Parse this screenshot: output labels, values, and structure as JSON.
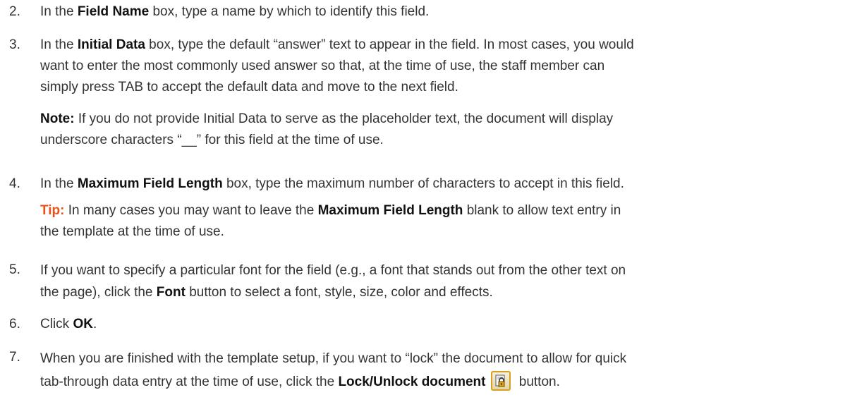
{
  "steps": [
    {
      "num": "2.",
      "parts": [
        "In the ",
        "Field Name",
        " box, type a name by which to identify this field."
      ]
    },
    {
      "num": "3.",
      "lines": [
        [
          "In the ",
          "Initial Data",
          " box, type the default “answer” text to appear in the field. In most cases, you would"
        ],
        "want to enter the most commonly used answer so that, at the time of use, the staff member can",
        "simply press TAB to accept the default data and move to the next field."
      ],
      "note": {
        "label": "Note:",
        "line1": " If you do not provide Initial Data to serve as the placeholder text, the document will display",
        "line2": "underscore characters “__” for this field at the time of use."
      }
    },
    {
      "num": "4.",
      "parts": [
        "In the ",
        "Maximum Field Length",
        " box, type the maximum number of characters to accept in this field."
      ],
      "tip": {
        "label": "Tip:",
        "pre": " In many cases you may want to leave the ",
        "bold": "Maximum Field Length",
        "post": " blank to allow text entry in",
        "line2": "the template at the time of use."
      }
    },
    {
      "num": "5.",
      "line1": "If you want to specify a particular font for the field (e.g., a font that stands out from the other text on",
      "line2": [
        "the page), click the ",
        "Font",
        " button to select a font, style, size, color and effects."
      ]
    },
    {
      "num": "6.",
      "parts": [
        "Click ",
        "OK",
        "."
      ]
    },
    {
      "num": "7.",
      "line1": "When you are finished with the template setup, if you want to “lock” the document to allow for quick",
      "line2": [
        "tab-through data entry at the time of use, click the ",
        "Lock/Unlock document",
        " button."
      ],
      "icon": "lock-document-icon"
    }
  ]
}
